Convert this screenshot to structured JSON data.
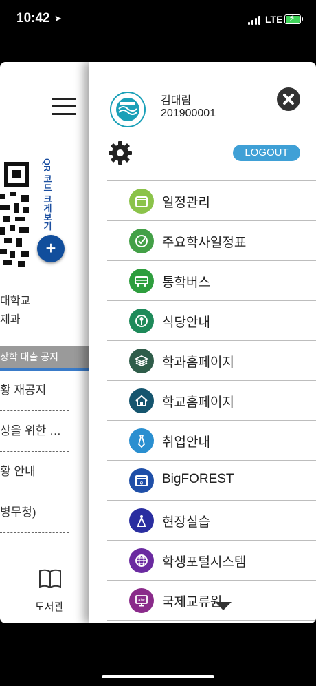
{
  "status_bar": {
    "time": "10:42",
    "network": "LTE",
    "location_icon": "location-arrow-icon",
    "battery_icon": "battery-charging-icon",
    "battery_color": "#3fd45a"
  },
  "background_screen": {
    "qr_label": "QR 코드 크게보기",
    "school_line1": "대학교",
    "school_line2": "제과",
    "active_notice": "장학 대출 공지",
    "notices": [
      "황 재공지",
      "상을 위한 …",
      "황 안내",
      "병무청)"
    ],
    "library_label": "도서관",
    "accent_color": "#114e9c"
  },
  "drawer": {
    "user": {
      "name": "김대림",
      "id": "201900001",
      "logo_icon": "university-seal-icon"
    },
    "logout_label": "LOGOUT",
    "logout_color": "#3fa0d6",
    "menu": [
      {
        "label": "일정관리",
        "icon": "calendar-icon",
        "color": "#8bc34a"
      },
      {
        "label": "주요학사일정표",
        "icon": "check-circle-icon",
        "color": "#43a047"
      },
      {
        "label": "통학버스",
        "icon": "bus-icon",
        "color": "#2e9e3e"
      },
      {
        "label": "식당안내",
        "icon": "restaurant-icon",
        "color": "#1e8a5a"
      },
      {
        "label": "학과홈페이지",
        "icon": "layers-icon",
        "color": "#2f5d4a"
      },
      {
        "label": "학교홈페이지",
        "icon": "home-icon",
        "color": "#15556e"
      },
      {
        "label": "취업안내",
        "icon": "necktie-icon",
        "color": "#2a8fd0"
      },
      {
        "label": "BigFOREST",
        "icon": "browser-window-icon",
        "color": "#1f4fa8"
      },
      {
        "label": "현장실습",
        "icon": "compass-icon",
        "color": "#2a2ea0"
      },
      {
        "label": "학생포털시스템",
        "icon": "globe-icon",
        "color": "#6a2aa0"
      },
      {
        "label": "국제교류원",
        "icon": "abc-monitor-icon",
        "color": "#8a2a8a"
      }
    ]
  }
}
